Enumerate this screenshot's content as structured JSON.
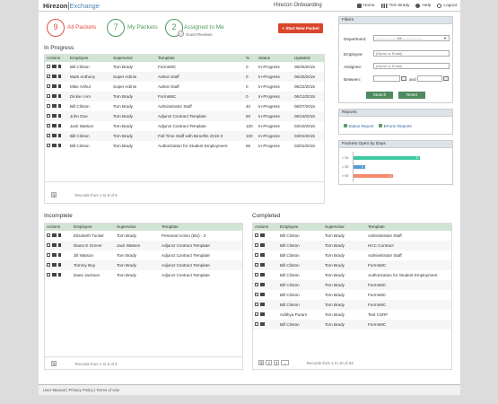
{
  "header": {
    "logo_main": "Hirezon",
    "logo_sub": "Exchange",
    "app_title": "Hirezon Onboarding",
    "nav": [
      {
        "label": "Home",
        "icon": "home-icon"
      },
      {
        "label": "Tom Brady",
        "icon": "user-grid-icon"
      },
      {
        "label": "Help",
        "icon": "help-icon"
      },
      {
        "label": "Logout",
        "icon": "logout-icon"
      }
    ]
  },
  "stats": {
    "all": {
      "count": "9",
      "label": "All Packets",
      "color": "#e0524a"
    },
    "my": {
      "count": "7",
      "label": "My Packets",
      "color": "#4f9a5e"
    },
    "assigned": {
      "count": "2",
      "label": "Assigned to Me",
      "sub_count": "0",
      "sub_label": "Guest Reviews",
      "color": "#4f9a5e"
    },
    "start_button": "+ Start New Packet"
  },
  "in_progress": {
    "title": "In Progress",
    "columns": [
      "Actions",
      "Employee",
      "Supervisor",
      "Template",
      "%",
      "Status",
      "Updated"
    ],
    "rows": [
      [
        "Bill Clinton",
        "Tom Brady",
        "FormsMC",
        "0",
        "In-Progress",
        "06/26/2015"
      ],
      [
        "Mark Anthony",
        "Super Admin",
        "Admin Staff",
        "0",
        "In-Progress",
        "06/25/2015"
      ],
      [
        "Mike Arthur",
        "Super Admin",
        "Admin Staff",
        "0",
        "In-Progress",
        "06/22/2015"
      ],
      [
        "Dickie I Am",
        "Tom Brady",
        "FormsMC",
        "0",
        "In-Progress",
        "06/12/2015"
      ],
      [
        "Bill Clinton",
        "Tom Brady",
        "Administrator Staff",
        "40",
        "In-Progress",
        "06/07/2015"
      ],
      [
        "John Doe",
        "Tom Brady",
        "Adjunct Contract Template",
        "50",
        "In-Progress",
        "05/18/2015"
      ],
      [
        "Jack Watson",
        "Tom Brady",
        "Adjunct Contract Template",
        "100",
        "In-Progress",
        "03/19/2015"
      ],
      [
        "Bill Clinton",
        "Tom Brady",
        "Full Time Staff with Benefits 2015-3",
        "100",
        "In-Progress",
        "03/02/2015"
      ],
      [
        "Bill Clinton",
        "Tom Brady",
        "Authorization for Student Employment",
        "66",
        "In-Progress",
        "03/02/2015"
      ]
    ],
    "page": "1",
    "records": "Records from 1 to 9 of 9"
  },
  "incomplete": {
    "title": "Incomplete",
    "columns": [
      "Actions",
      "Employee",
      "Supervisor",
      "Template"
    ],
    "rows": [
      [
        "Elizabeth Tucker",
        "Tom Brady",
        "Personal Action (BU) - 2"
      ],
      [
        "Diane E Grover",
        "Jack Watson",
        "Adjunct Contract Template"
      ],
      [
        "Jill Watson",
        "Tom Brady",
        "Adjunct Contract Template"
      ],
      [
        "Tommy Boy",
        "Tom Brady",
        "Adjunct Contract Template"
      ],
      [
        "Dane Jackson",
        "Tom Brady",
        "Adjunct Contract Template"
      ]
    ],
    "page": "1",
    "records": "Records from 1 to 5 of 5"
  },
  "completed": {
    "title": "Completed",
    "columns": [
      "Actions",
      "Employee",
      "Supervisor",
      "Template"
    ],
    "rows": [
      [
        "Bill Clinton",
        "Tom Brady",
        "Administrator Staff"
      ],
      [
        "Bill Clinton",
        "Tom Brady",
        "HCC Contract"
      ],
      [
        "Bill Clinton",
        "Tom Brady",
        "Administrator Staff"
      ],
      [
        "Bill Clinton",
        "Tom Brady",
        "FormsMC"
      ],
      [
        "Bill Clinton",
        "Tom Brady",
        "Authorization for Student Employment"
      ],
      [
        "Bill Clinton",
        "Tom Brady",
        "FormsMC"
      ],
      [
        "Bill Clinton",
        "Tom Brady",
        "FormsMC"
      ],
      [
        "Bill Clinton",
        "Tom Brady",
        "FormsMC"
      ],
      [
        "Adithya Puram",
        "Tom Brady",
        "Test CSRF"
      ],
      [
        "Bill Clinton",
        "Tom Brady",
        "FormsMC"
      ]
    ],
    "pages": [
      "1",
      "2",
      "3",
      "→"
    ],
    "records": "Records from 1 to 10 of 63"
  },
  "filters": {
    "title": "Filters",
    "department_label": "Department:",
    "department_value": "------------------All------------------",
    "employee_label": "Employee:",
    "employee_placeholder": "(Name or Email)",
    "assignee_label": "Assignee:",
    "assignee_placeholder": "(Name or Email)",
    "between_label": "Between:",
    "and_label": "and",
    "search_button": "Search",
    "reset_button": "Reset"
  },
  "reports": {
    "title": "Reports",
    "items": [
      "Status Report",
      "EForm Reports"
    ]
  },
  "packets_open": {
    "title": "Packets Open by Days",
    "bars": [
      {
        "label": "< 30",
        "value": "5",
        "color": "#3ec9a0",
        "fraction": 0.74
      },
      {
        "label": "> 30",
        "value": "1",
        "color": "#5b9bd5",
        "fraction": 0.13
      },
      {
        "label": "> 90",
        "value": "3",
        "color": "#f08a6c",
        "fraction": 0.44
      }
    ]
  },
  "footer": {
    "links": [
      "User Manual",
      "Privacy Policy",
      "Terms of Use"
    ]
  }
}
